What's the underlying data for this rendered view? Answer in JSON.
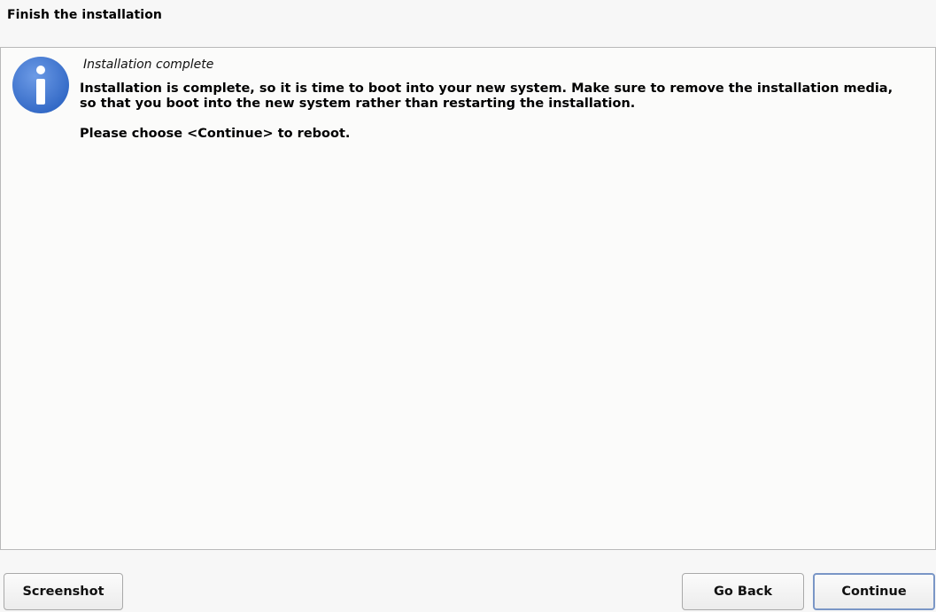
{
  "header": {
    "title": "Finish the installation"
  },
  "message": {
    "icon": "info-icon",
    "heading": "Installation complete",
    "body_line_1": "Installation is complete, so it is time to boot into your new system. Make sure to remove the installation media, so that you boot into the new system rather than restarting the installation.",
    "body_line_2": "Please choose <Continue> to reboot."
  },
  "buttons": {
    "screenshot": "Screenshot",
    "go_back": "Go Back",
    "continue": "Continue"
  },
  "colors": {
    "icon_blue": "#3f78d4",
    "focus_border": "#7a96c6"
  }
}
